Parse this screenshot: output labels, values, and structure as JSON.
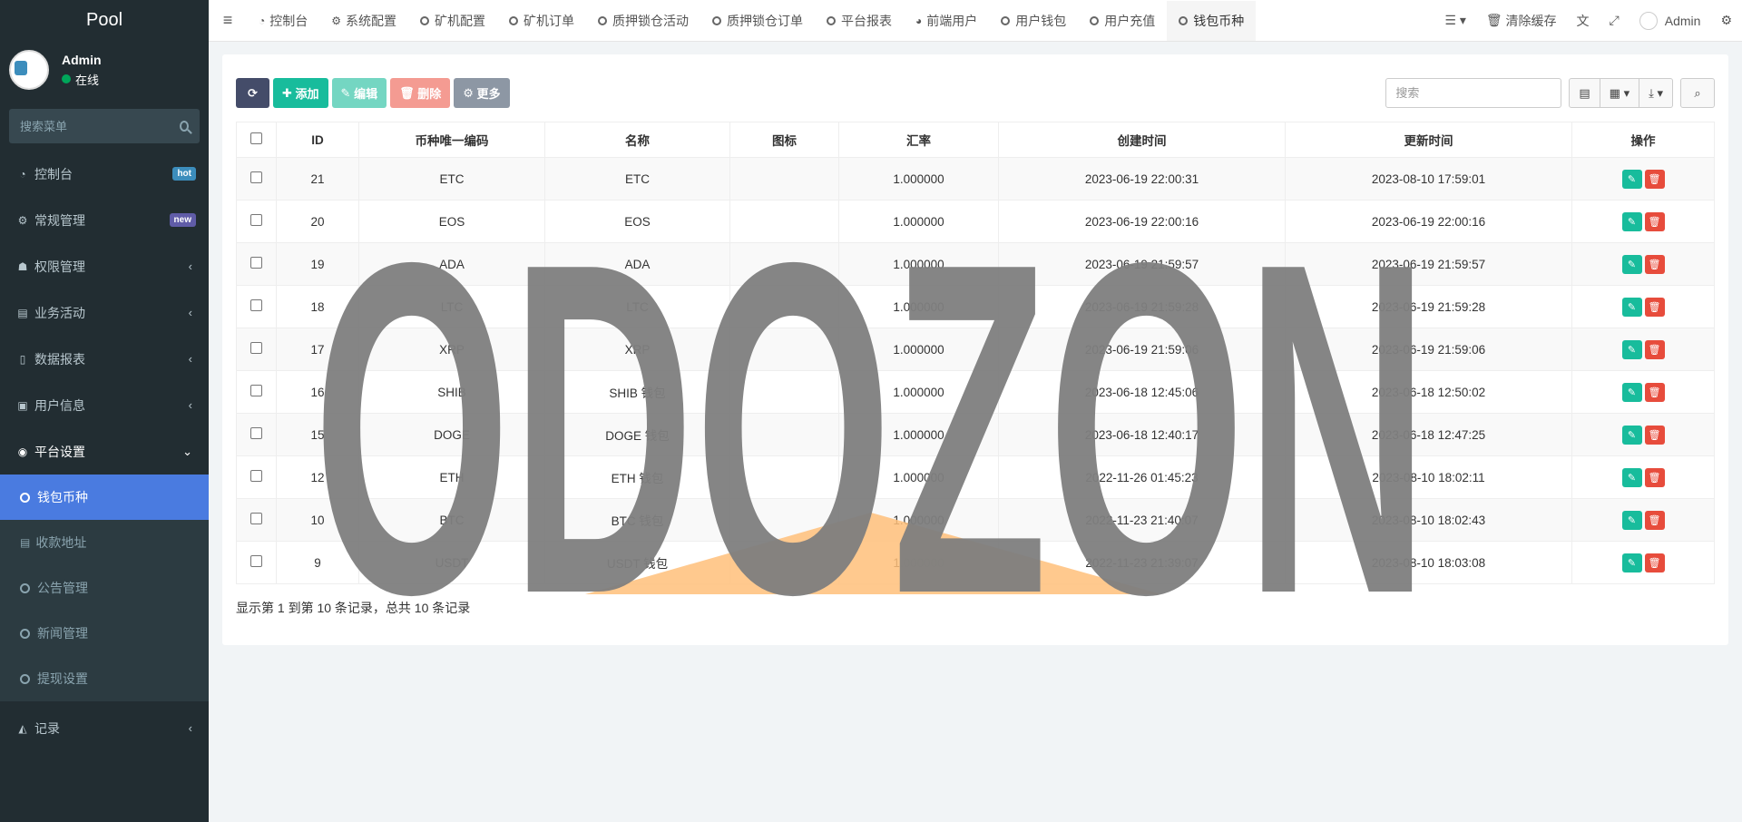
{
  "brand": "Pool",
  "user": {
    "name": "Admin",
    "status": "在线"
  },
  "sidebar_search_placeholder": "搜索菜单",
  "sidebar": {
    "items": [
      {
        "label": "控制台",
        "icon": "dashboard-icon",
        "badge": "hot",
        "badge_color": "#3c8dbc"
      },
      {
        "label": "常规管理",
        "icon": "cogs-icon",
        "badge": "new",
        "badge_color": "#605ca8"
      },
      {
        "label": "权限管理",
        "icon": "group-icon"
      },
      {
        "label": "业务活动",
        "icon": "id-card-icon"
      },
      {
        "label": "数据报表",
        "icon": "file-icon"
      },
      {
        "label": "用户信息",
        "icon": "user-card-icon"
      },
      {
        "label": "平台设置",
        "icon": "palette-icon"
      }
    ],
    "submenu": [
      {
        "label": "钱包币种",
        "active": true
      },
      {
        "label": "收款地址"
      },
      {
        "label": "公告管理"
      },
      {
        "label": "新闻管理"
      },
      {
        "label": "提现设置"
      }
    ],
    "last_item": {
      "label": "记录",
      "icon": "area-chart-icon"
    }
  },
  "tabs": [
    {
      "label": "控制台",
      "icon": "dashboard-icon"
    },
    {
      "label": "系统配置",
      "icon": "gear-icon"
    },
    {
      "label": "矿机配置",
      "icon": "circle-icon"
    },
    {
      "label": "矿机订单",
      "icon": "circle-icon"
    },
    {
      "label": "质押锁仓活动",
      "icon": "circle-icon"
    },
    {
      "label": "质押锁仓订单",
      "icon": "circle-icon"
    },
    {
      "label": "平台报表",
      "icon": "circle-icon"
    },
    {
      "label": "前端用户",
      "icon": "user-circle-icon"
    },
    {
      "label": "用户钱包",
      "icon": "circle-icon"
    },
    {
      "label": "用户充值",
      "icon": "circle-icon"
    },
    {
      "label": "钱包币种",
      "icon": "circle-icon",
      "active": true
    }
  ],
  "topbar_right": {
    "clear_cache": "清除缓存",
    "admin": "Admin"
  },
  "toolbar": {
    "add": "添加",
    "edit": "编辑",
    "delete": "删除",
    "more": "更多",
    "search_placeholder": "搜索"
  },
  "table": {
    "headers": [
      "ID",
      "币种唯一编码",
      "名称",
      "图标",
      "汇率",
      "创建时间",
      "更新时间",
      "操作"
    ],
    "rows": [
      {
        "id": "21",
        "code": "ETC",
        "name": "ETC",
        "rate": "1.000000",
        "created": "2023-06-19 22:00:31",
        "updated": "2023-08-10 17:59:01"
      },
      {
        "id": "20",
        "code": "EOS",
        "name": "EOS",
        "rate": "1.000000",
        "created": "2023-06-19 22:00:16",
        "updated": "2023-06-19 22:00:16"
      },
      {
        "id": "19",
        "code": "ADA",
        "name": "ADA",
        "rate": "1.000000",
        "created": "2023-06-19 21:59:57",
        "updated": "2023-06-19 21:59:57"
      },
      {
        "id": "18",
        "code": "LTC",
        "name": "LTC",
        "rate": "1.000000",
        "created": "2023-06-19 21:59:28",
        "updated": "2023-06-19 21:59:28"
      },
      {
        "id": "17",
        "code": "XRP",
        "name": "XRP",
        "rate": "1.000000",
        "created": "2023-06-19 21:59:06",
        "updated": "2023-06-19 21:59:06"
      },
      {
        "id": "16",
        "code": "SHIB",
        "name": "SHIB 钱包",
        "rate": "1.000000",
        "created": "2023-06-18 12:45:06",
        "updated": "2023-06-18 12:50:02"
      },
      {
        "id": "15",
        "code": "DOGE",
        "name": "DOGE 钱包",
        "rate": "1.000000",
        "created": "2023-06-18 12:40:17",
        "updated": "2023-06-18 12:47:25"
      },
      {
        "id": "12",
        "code": "ETH",
        "name": "ETH 钱包",
        "rate": "1.000000",
        "created": "2022-11-26 01:45:23",
        "updated": "2023-08-10 18:02:11"
      },
      {
        "id": "10",
        "code": "BTC",
        "name": "BTC 钱包",
        "rate": "1.000000",
        "created": "2022-11-23 21:40:07",
        "updated": "2023-08-10 18:02:43"
      },
      {
        "id": "9",
        "code": "USDT",
        "name": "USDT 钱包",
        "rate": "1.000000",
        "created": "2022-11-23 21:39:07",
        "updated": "2023-08-10 18:03:08"
      }
    ]
  },
  "footer_info": "显示第 1 到第 10 条记录，总共 10 条记录",
  "watermark_text": "ODOZON",
  "colors": {
    "sidebar_bg": "#222d32",
    "active_sub": "#4a7be0",
    "add": "#18bc9c",
    "delete": "#e74c3c",
    "watermark": "#7f7f7f",
    "watermark_accent": "#ffc07a"
  }
}
